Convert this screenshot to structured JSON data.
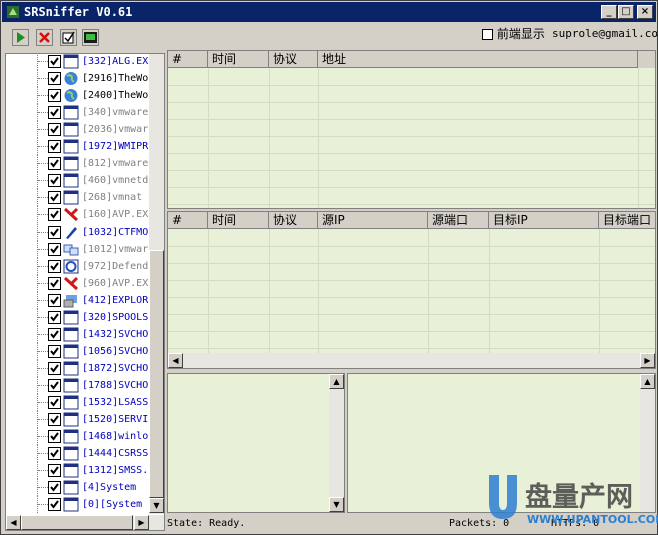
{
  "window": {
    "title": "SRSniffer V0.61",
    "minimize": "_",
    "maximize": "□",
    "close": "×"
  },
  "toolbar": {
    "buttons": [
      "start-icon",
      "stop-icon",
      "clear-icon",
      "export-icon"
    ]
  },
  "topright": {
    "foreground_label": "前端显示",
    "email": "suprole@gmail.com"
  },
  "processes": [
    {
      "text": "[332]ALG.EX",
      "color": "#0000c0",
      "icon": "window-icon"
    },
    {
      "text": "[2916]TheWo",
      "color": "#000000",
      "icon": "globe-icon"
    },
    {
      "text": "[2400]TheWo",
      "color": "#000000",
      "icon": "globe-icon"
    },
    {
      "text": "[340]vmware",
      "color": "#808080",
      "icon": "window-icon"
    },
    {
      "text": "[2036]vmwar",
      "color": "#808080",
      "icon": "window-icon"
    },
    {
      "text": "[1972]WMIPR",
      "color": "#0000c0",
      "icon": "window-icon"
    },
    {
      "text": "[812]vmware",
      "color": "#808080",
      "icon": "window-icon"
    },
    {
      "text": "[460]vmnetd",
      "color": "#808080",
      "icon": "window-icon"
    },
    {
      "text": "[268]vmnat",
      "color": "#808080",
      "icon": "window-icon"
    },
    {
      "text": "[160]AVP.EX",
      "color": "#808080",
      "icon": "kaspersky-icon"
    },
    {
      "text": "[1032]CTFMO",
      "color": "#0000c0",
      "icon": "pen-icon"
    },
    {
      "text": "[1012]vmwar",
      "color": "#808080",
      "icon": "network-icon"
    },
    {
      "text": "[972]Defend",
      "color": "#808080",
      "icon": "defender-icon"
    },
    {
      "text": "[960]AVP.EX",
      "color": "#808080",
      "icon": "kaspersky-icon"
    },
    {
      "text": "[412]EXPLOR",
      "color": "#0000c0",
      "icon": "explorer-icon"
    },
    {
      "text": "[320]SPOOLS",
      "color": "#0000c0",
      "icon": "window-icon"
    },
    {
      "text": "[1432]SVCHO",
      "color": "#0000c0",
      "icon": "window-icon"
    },
    {
      "text": "[1056]SVCHO",
      "color": "#0000c0",
      "icon": "window-icon"
    },
    {
      "text": "[1872]SVCHO",
      "color": "#0000c0",
      "icon": "window-icon"
    },
    {
      "text": "[1788]SVCHO",
      "color": "#0000c0",
      "icon": "window-icon"
    },
    {
      "text": "[1532]LSASS",
      "color": "#0000c0",
      "icon": "window-icon"
    },
    {
      "text": "[1520]SERVI",
      "color": "#0000c0",
      "icon": "window-icon"
    },
    {
      "text": "[1468]winlo",
      "color": "#0000c0",
      "icon": "window-icon"
    },
    {
      "text": "[1444]CSRSS",
      "color": "#0000c0",
      "icon": "window-icon"
    },
    {
      "text": "[1312]SMSS.",
      "color": "#0000c0",
      "icon": "window-icon"
    },
    {
      "text": "[4]System",
      "color": "#0000c0",
      "icon": "window-icon"
    },
    {
      "text": "[0][System",
      "color": "#0000c0",
      "icon": "window-icon"
    }
  ],
  "top_table": {
    "columns": [
      "#",
      "时间",
      "协议",
      "地址"
    ]
  },
  "middle_table": {
    "columns": [
      "#",
      "时间",
      "协议",
      "源IP",
      "源端口",
      "目标IP",
      "目标端口"
    ]
  },
  "status": {
    "state": "State: Ready.",
    "packets": "Packets: 0",
    "http": "HTTPs: 0"
  },
  "watermark": {
    "logo": "盘量产网",
    "url": "WWW.UPANTOOL.COM"
  }
}
